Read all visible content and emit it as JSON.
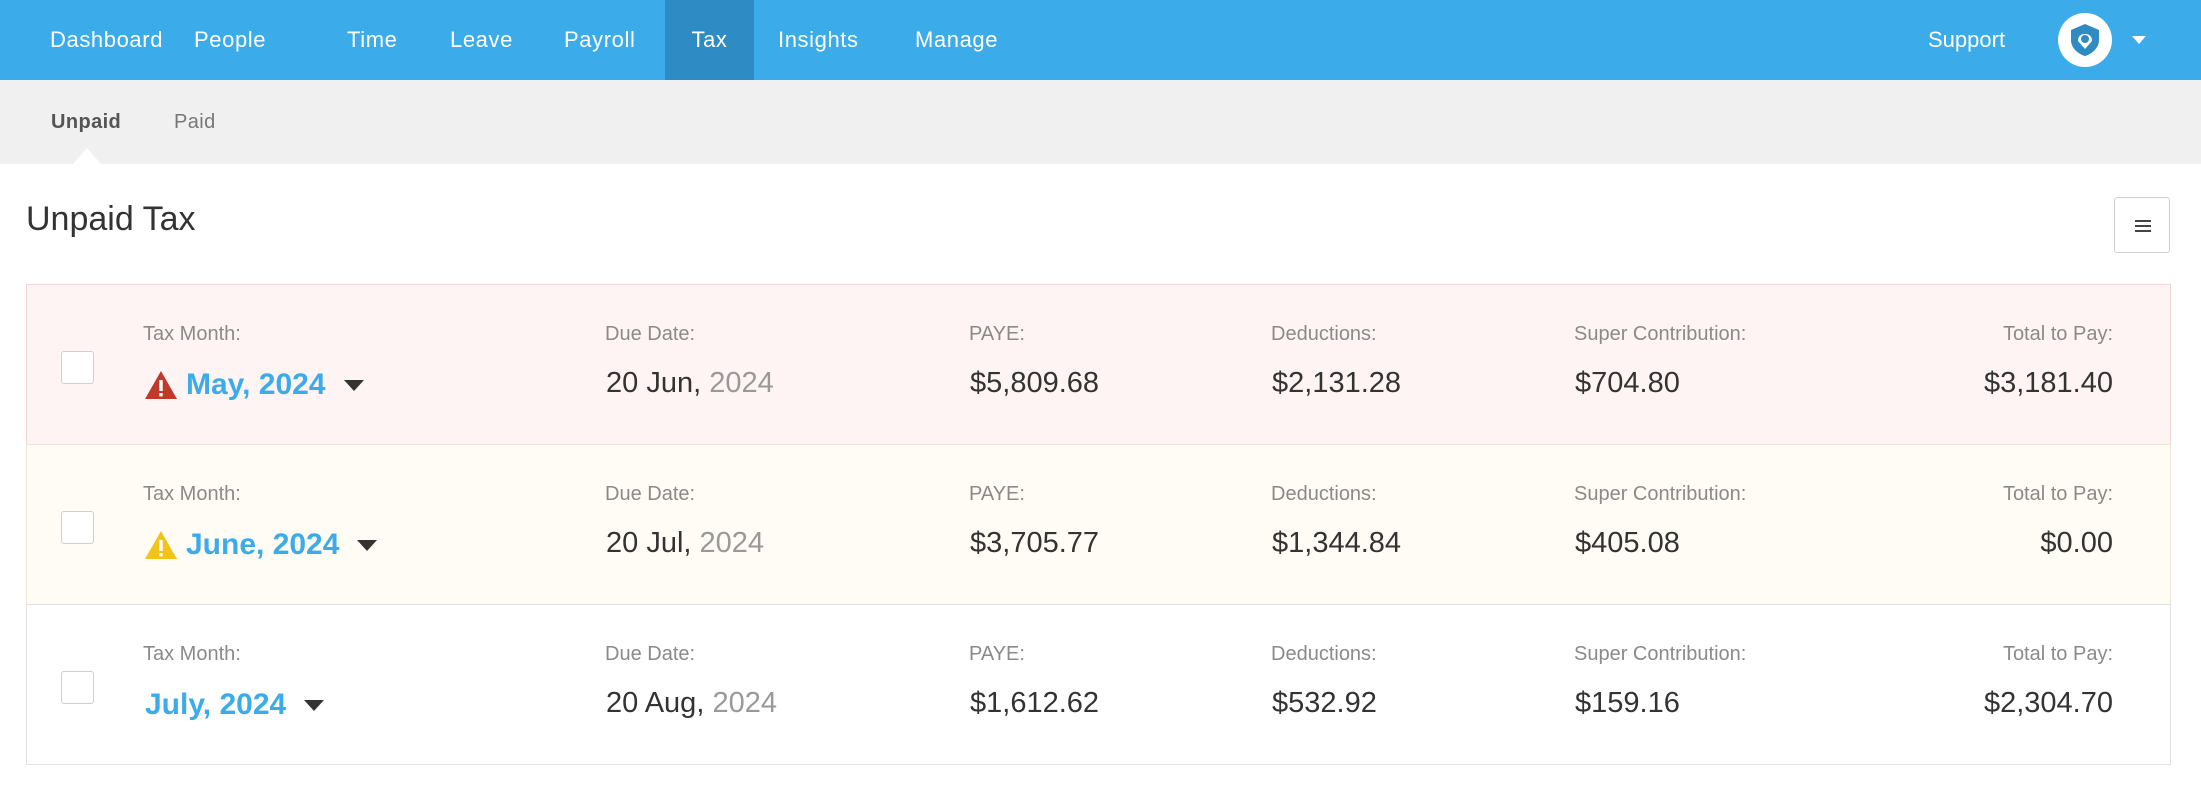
{
  "topnav": {
    "items": [
      {
        "label": "Dashboard",
        "active": false
      },
      {
        "label": "People",
        "active": false
      },
      {
        "label": "Time",
        "active": false
      },
      {
        "label": "Leave",
        "active": false
      },
      {
        "label": "Payroll",
        "active": false
      },
      {
        "label": "Tax",
        "active": true
      },
      {
        "label": "Insights",
        "active": false
      },
      {
        "label": "Manage",
        "active": false
      }
    ],
    "support_label": "Support",
    "avatar_icon": "logo-shield-icon"
  },
  "subnav": {
    "items": [
      {
        "label": "Unpaid",
        "active": true
      },
      {
        "label": "Paid",
        "active": false
      }
    ]
  },
  "page": {
    "title": "Unpaid Tax",
    "menu_icon": "hamburger-icon"
  },
  "labels": {
    "tax_month": "Tax Month:",
    "due_date": "Due Date:",
    "paye": "PAYE:",
    "deductions": "Deductions:",
    "super": "Super Contribution:",
    "total": "Total to Pay:"
  },
  "rows": [
    {
      "status": "overdue",
      "status_icon": "warning-triangle-red-icon",
      "month": "May, 2024",
      "due_day": "20 Jun,",
      "due_year": "2024",
      "paye": "$5,809.68",
      "deductions": "$2,131.28",
      "super": "$704.80",
      "total": "$3,181.40"
    },
    {
      "status": "warning",
      "status_icon": "warning-triangle-yellow-icon",
      "month": "June, 2024",
      "due_day": "20 Jul,",
      "due_year": "2024",
      "paye": "$3,705.77",
      "deductions": "$1,344.84",
      "super": "$405.08",
      "total": "$0.00"
    },
    {
      "status": "normal",
      "status_icon": "",
      "month": "July, 2024",
      "due_day": "20 Aug,",
      "due_year": "2024",
      "paye": "$1,612.62",
      "deductions": "$532.92",
      "super": "$159.16",
      "total": "$2,304.70"
    }
  ],
  "colors": {
    "nav_bg": "#3babea",
    "nav_active_bg": "#2e8bc4",
    "link": "#3babea",
    "overdue_icon": "#c0392b",
    "warning_icon": "#f0c419"
  }
}
